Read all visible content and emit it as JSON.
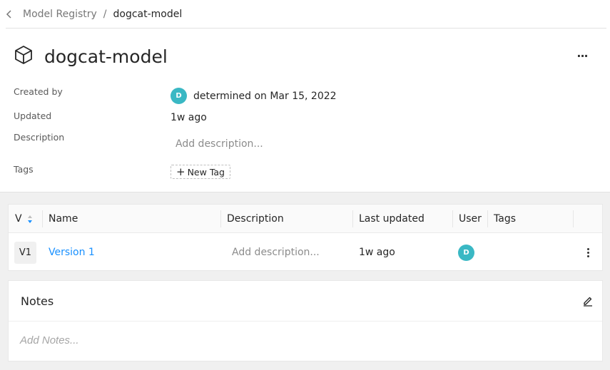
{
  "breadcrumb": {
    "back_icon": "chevron-left-icon",
    "parent": "Model Registry",
    "separator": "/",
    "current": "dogcat-model"
  },
  "header": {
    "icon": "cube-icon",
    "title": "dogcat-model",
    "more_label": "···"
  },
  "meta": {
    "created_by_label": "Created by",
    "created_by_avatar": "D",
    "created_by_value": "determined on Mar 15, 2022",
    "updated_label": "Updated",
    "updated_value": "1w ago",
    "description_label": "Description",
    "description_placeholder": "Add description...",
    "tags_label": "Tags",
    "new_tag_label": "New Tag"
  },
  "table": {
    "columns": [
      "V",
      "Name",
      "Description",
      "Last updated",
      "User",
      "Tags"
    ],
    "rows": [
      {
        "version": "V1",
        "name": "Version 1",
        "description": "Add description...",
        "last_updated": "1w ago",
        "user_avatar": "D",
        "tags": ""
      }
    ]
  },
  "notes": {
    "title": "Notes",
    "placeholder": "Add Notes..."
  },
  "colors": {
    "accent": "#1890ff",
    "avatar": "#3ab8c4",
    "page_bg": "#f0f0f0"
  }
}
